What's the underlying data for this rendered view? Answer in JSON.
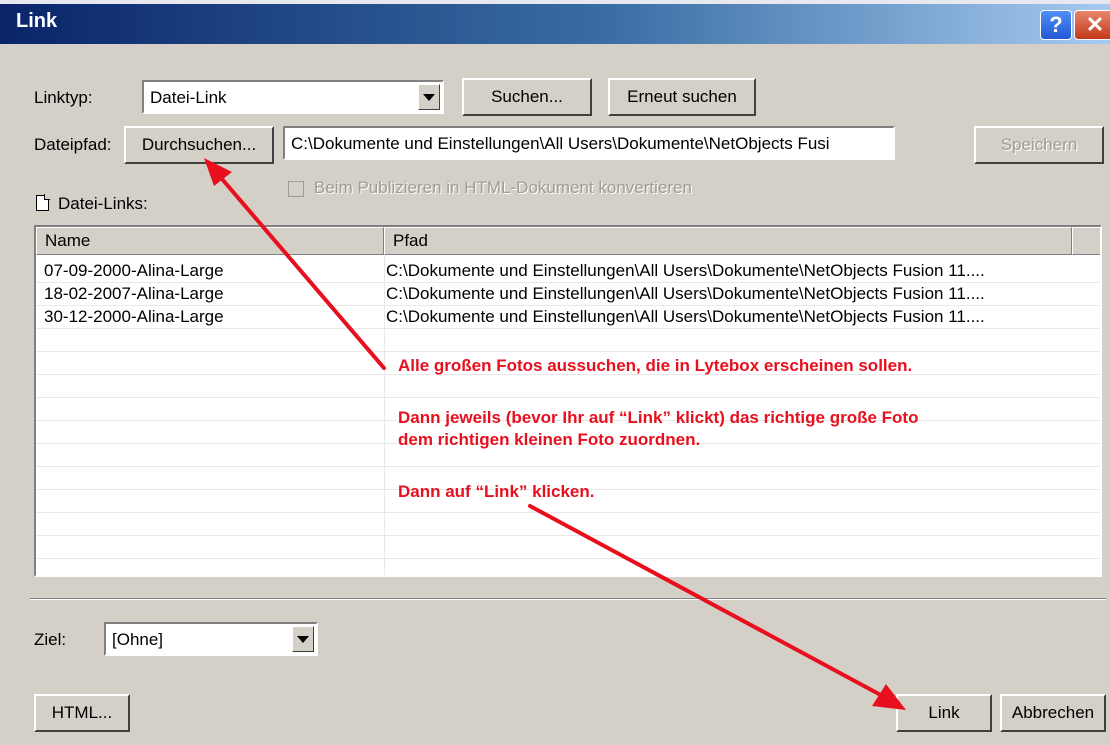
{
  "window": {
    "title": "Link",
    "help_glyph": "?",
    "close_glyph": "✕"
  },
  "linktyp": {
    "label": "Linktyp:",
    "value": "Datei-Link"
  },
  "buttons": {
    "suchen": "Suchen...",
    "erneut": "Erneut suchen",
    "durchsuchen": "Durchsuchen...",
    "speichern": "Speichern",
    "html": "HTML...",
    "link": "Link",
    "abbrechen": "Abbrechen"
  },
  "dateipfad": {
    "label": "Dateipfad:",
    "value": "C:\\Dokumente und Einstellungen\\All Users\\Dokumente\\NetObjects Fusi"
  },
  "checkbox": {
    "label": "Beim Publizieren in HTML-Dokument konvertieren",
    "checked": false
  },
  "file_links": {
    "label": "Datei-Links:",
    "columns": [
      "Name",
      "Pfad"
    ],
    "rows": [
      {
        "name": "07-09-2000-Alina-Large",
        "path": "C:\\Dokumente und Einstellungen\\All Users\\Dokumente\\NetObjects Fusion 11...."
      },
      {
        "name": "18-02-2007-Alina-Large",
        "path": "C:\\Dokumente und Einstellungen\\All Users\\Dokumente\\NetObjects Fusion 11...."
      },
      {
        "name": "30-12-2000-Alina-Large",
        "path": "C:\\Dokumente und Einstellungen\\All Users\\Dokumente\\NetObjects Fusion 11...."
      }
    ]
  },
  "ziel": {
    "label": "Ziel:",
    "value": "[Ohne]"
  },
  "annotations": {
    "line1": "Alle großen Fotos aussuchen, die in Lytebox erscheinen sollen.",
    "line2": "Dann jeweils (bevor Ihr auf “Link” klickt) das richtige große Foto",
    "line3": "dem richtigen kleinen Foto zuordnen.",
    "line4": "Dann auf “Link” klicken.",
    "color": "#e8101e"
  },
  "colors": {
    "dialog_bg": "#d4d0c8",
    "titlebar": "#0a246a"
  }
}
